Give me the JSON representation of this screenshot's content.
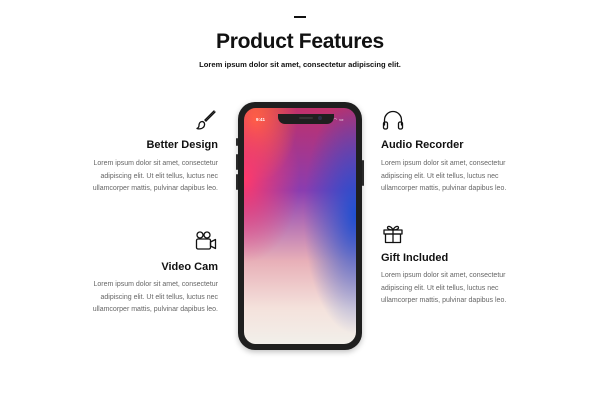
{
  "header": {
    "title": "Product Features",
    "subtitle": "Lorem ipsum dolor sit amet, consectetur adipiscing elit."
  },
  "features": {
    "better_design": {
      "title": "Better Design",
      "icon": "paintbrush-icon",
      "desc": [
        "Lorem ipsum dolor sit amet, consectetur",
        "adipiscing elit. Ut elit tellus, luctus nec",
        "ullamcorper mattis, pulvinar dapibus leo."
      ]
    },
    "video_cam": {
      "title": "Video Cam",
      "icon": "video-camera-icon",
      "desc": [
        "Lorem ipsum dolor sit amet, consectetur",
        "adipiscing elit. Ut elit tellus, luctus nec",
        "ullamcorper mattis, pulvinar dapibus leo."
      ]
    },
    "audio_recorder": {
      "title": "Audio Recorder",
      "icon": "headphones-icon",
      "desc": [
        "Lorem ipsum dolor sit amet, consectetur",
        "adipiscing elit. Ut elit tellus, luctus nec",
        "ullamcorper mattis, pulvinar dapibus leo."
      ]
    },
    "gift_included": {
      "title": "Gift Included",
      "icon": "gift-icon",
      "desc": [
        "Lorem ipsum dolor sit amet, consectetur",
        "adipiscing elit. Ut elit tellus, luctus nec",
        "ullamcorper mattis, pulvinar dapibus leo."
      ]
    }
  },
  "phone": {
    "time": "9:41",
    "status": "▮▮ ◠ ▭"
  },
  "colors": {
    "heading": "#111111",
    "body_text": "#666666",
    "phone_frame": "#1f1f1f"
  }
}
